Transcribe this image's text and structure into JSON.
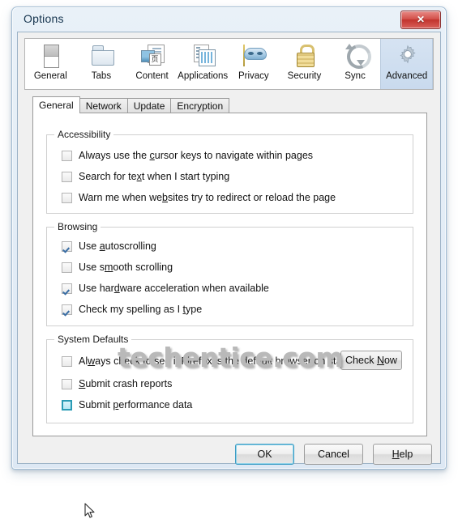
{
  "window": {
    "title": "Options",
    "close_label": "✕"
  },
  "panes": [
    {
      "id": "general",
      "label": "General",
      "icon": "monitor-icon",
      "selected": false
    },
    {
      "id": "tabs",
      "label": "Tabs",
      "icon": "folder-tabs-icon",
      "selected": false
    },
    {
      "id": "content",
      "label": "Content",
      "icon": "content-page-icon",
      "selected": false
    },
    {
      "id": "applications",
      "label": "Applications",
      "icon": "applications-icon",
      "selected": false
    },
    {
      "id": "privacy",
      "label": "Privacy",
      "icon": "mask-icon",
      "selected": false
    },
    {
      "id": "security",
      "label": "Security",
      "icon": "padlock-icon",
      "selected": false
    },
    {
      "id": "sync",
      "label": "Sync",
      "icon": "sync-arrows-icon",
      "selected": false
    },
    {
      "id": "advanced",
      "label": "Advanced",
      "icon": "gear-icon",
      "selected": true
    }
  ],
  "subtabs": [
    {
      "id": "general",
      "label": "General",
      "active": true
    },
    {
      "id": "network",
      "label": "Network",
      "active": false
    },
    {
      "id": "update",
      "label": "Update",
      "active": false
    },
    {
      "id": "encryption",
      "label": "Encryption",
      "active": false
    }
  ],
  "groups": {
    "accessibility": {
      "title": "Accessibility",
      "items": [
        {
          "label": "Always use the cursor keys to navigate within pages",
          "accel": "c",
          "checked": false,
          "hover": false
        },
        {
          "label": "Search for text when I start typing",
          "accel": "x",
          "checked": false,
          "hover": false
        },
        {
          "label": "Warn me when websites try to redirect or reload the page",
          "accel": "b",
          "checked": false,
          "hover": false
        }
      ]
    },
    "browsing": {
      "title": "Browsing",
      "items": [
        {
          "label": "Use autoscrolling",
          "accel": "a",
          "checked": true,
          "hover": false
        },
        {
          "label": "Use smooth scrolling",
          "accel": "m",
          "checked": false,
          "hover": false
        },
        {
          "label": "Use hardware acceleration when available",
          "accel": "d",
          "checked": true,
          "hover": false
        },
        {
          "label": "Check my spelling as I type",
          "accel": "t",
          "checked": true,
          "hover": false
        }
      ]
    },
    "system_defaults": {
      "title": "System Defaults",
      "items": [
        {
          "label": "Always check to see if Firefox is the default browser on startup",
          "accel": "w",
          "checked": false,
          "hover": false
        },
        {
          "label": "Submit crash reports",
          "accel": "S",
          "checked": false,
          "hover": false
        },
        {
          "label": "Submit performance data",
          "accel": "p",
          "checked": false,
          "hover": true
        }
      ],
      "check_now_label": "Check Now",
      "check_now_accel": "N"
    }
  },
  "footer": {
    "ok_label": "OK",
    "cancel_label": "Cancel",
    "help_label": "Help",
    "help_accel": "H"
  },
  "watermark": {
    "text": "techentice.com"
  },
  "colors": {
    "accent": "#3a6ea5",
    "selected_pane_bg": "#cdddee",
    "hover_checkbox": "#2a9bb5",
    "close_button": "#c2342e",
    "watermark": "#b9b9b9"
  }
}
